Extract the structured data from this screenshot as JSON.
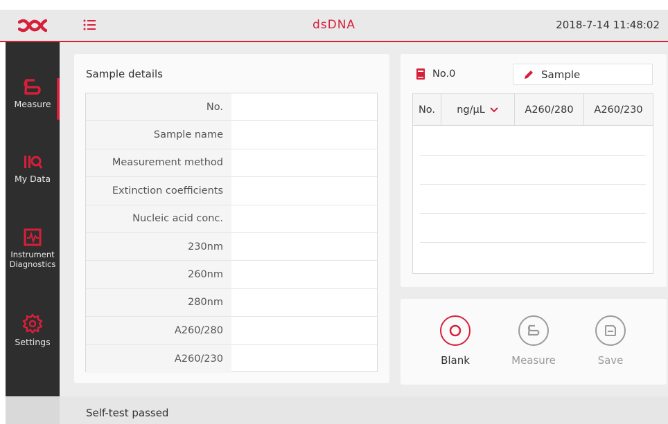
{
  "header": {
    "title": "dsDNA",
    "datetime": "2018-7-14  11:48:02"
  },
  "sidebar": {
    "items": [
      {
        "label": "Measure",
        "icon": "measure-icon",
        "active": true
      },
      {
        "label": "My Data",
        "icon": "my-data-icon",
        "active": false
      },
      {
        "label": "Instrument Diagnostics",
        "icon": "diagnostics-icon",
        "active": false
      },
      {
        "label": "Settings",
        "icon": "gear-icon",
        "active": false
      }
    ]
  },
  "details": {
    "title": "Sample details",
    "rows": [
      {
        "key": "No.",
        "value": ""
      },
      {
        "key": "Sample name",
        "value": ""
      },
      {
        "key": "Measurement method",
        "value": ""
      },
      {
        "key": "Extinction coefficients",
        "value": ""
      },
      {
        "key": "Nucleic acid conc.",
        "value": ""
      },
      {
        "key": "230nm",
        "value": ""
      },
      {
        "key": "260nm",
        "value": ""
      },
      {
        "key": "280nm",
        "value": ""
      },
      {
        "key": "A260/280",
        "value": ""
      },
      {
        "key": "A260/230",
        "value": ""
      }
    ]
  },
  "results": {
    "record_label": "No.0",
    "sample_value": "Sample",
    "columns": [
      "No.",
      "ng/µL",
      "A260/280",
      "A260/230"
    ]
  },
  "actions": {
    "blank": "Blank",
    "measure": "Measure",
    "save": "Save"
  },
  "status": {
    "text": "Self-test passed"
  },
  "colors": {
    "accent": "#d71f3a",
    "sidebar_bg": "#2e2e2e",
    "disabled": "#9a9a9a"
  }
}
